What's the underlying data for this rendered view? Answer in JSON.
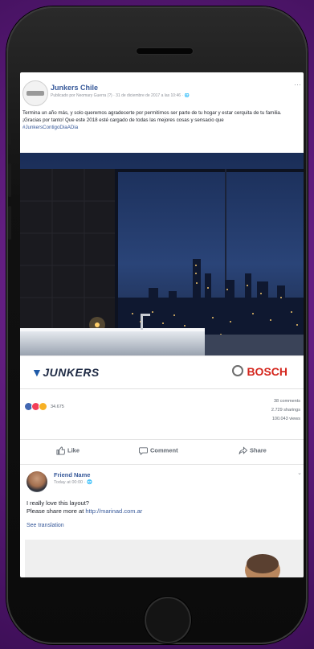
{
  "post": {
    "page_name": "Junkers Chile",
    "meta": "Publicado por Neomary Guerra (?) · 31 de diciembre de 2017 a las 10:46 · 🌐",
    "text": "Termina un año más, y solo queremos agradecerte por permitirnos ser parte de tu hogar y estar cerquita de tu familia. ¡Gracias por tanto! Que este 2018 esté cargado de todas las mejores cosas y sensacio que",
    "hashtag": "#JunkersContigoDiaADia",
    "brand_left": "JUNKERS",
    "brand_right": "BOSCH"
  },
  "stats": {
    "reactions_count": "34.675",
    "comments": "38 comments",
    "shares": "2.729 sharings",
    "views": "100.043 views"
  },
  "actions": {
    "like": "Like",
    "comment": "Comment",
    "share": "Share"
  },
  "comment": {
    "author": "Friend Name",
    "time": "Today at 00:00 · 🌐",
    "line1": "I really love this layout?",
    "line2_prefix": "Please share more at ",
    "link": "http://marinad.com.ar",
    "see_translation": "See translation"
  },
  "icons": {
    "like": "thumbs-up-icon",
    "comment": "comment-bubble-icon",
    "share": "share-arrow-icon",
    "more": "more-options-icon"
  },
  "colors": {
    "background": "#5a1a78",
    "link_blue": "#365899",
    "bosch_red": "#d4251c"
  }
}
